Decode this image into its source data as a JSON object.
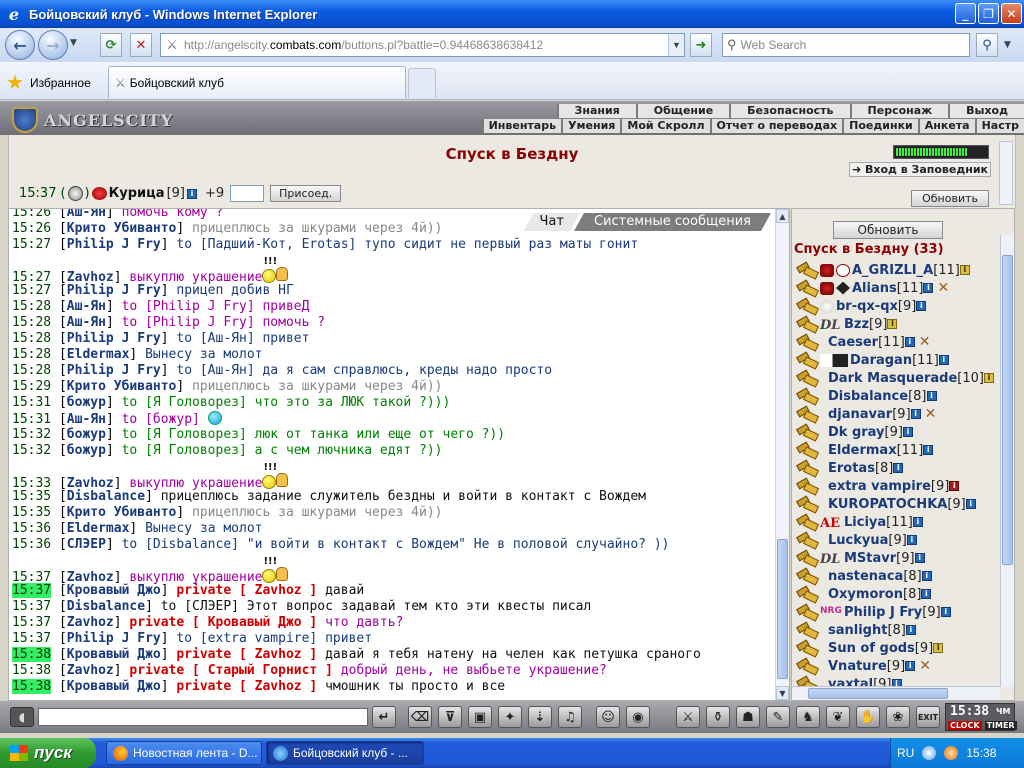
{
  "window": {
    "title": "Бойцовский клуб - Windows Internet Explorer"
  },
  "browser": {
    "url_prefix": "http://angelscity.",
    "url_domain": "combats.com",
    "url_rest": "/buttons.pl?battle=0.94468638638412",
    "search_placeholder": "Web Search",
    "favorites_label": "Избранное",
    "tab_title": "Бойцовский клуб"
  },
  "game": {
    "logo": "ANGELSCITY",
    "menu_top": [
      "Знания",
      "Общение",
      "Безопасность",
      "Персонаж",
      "Выход"
    ],
    "menu_bottom": [
      "Инвентарь",
      "Умения",
      "Мой Скролл",
      "Отчет о переводах",
      "Поединки",
      "Анкета",
      "Настр"
    ],
    "location_title": "Спуск в Бездну",
    "enter_label": "Вход в Заповедник",
    "refresh_label": "Обновить",
    "user": {
      "time": "15:37",
      "nick": "Курица",
      "level": "[9]",
      "bonus": "+9",
      "sit_label": "Присоед."
    }
  },
  "chat": {
    "tabs": {
      "chat": "Чат",
      "system": "Системные сообщения"
    },
    "lines": [
      {
        "time": "15:26",
        "nick": "Аш-Ян",
        "text": "помочь кому ?",
        "color": "purple"
      },
      {
        "time": "15:26",
        "nick": "Крито Убиванто",
        "text": "прицеплюсь за шкурами через 4й))",
        "color": "gray"
      },
      {
        "time": "15:27",
        "nick": "Philip J Fry",
        "to": "to [Падший-Кот, Erotas]",
        "text": "тупо сидит не первый раз маты гонит",
        "color": "navy"
      },
      {
        "time": "15:27",
        "nick": "Zavhoz",
        "text": "выкуплю украшение",
        "color": "purple",
        "smile": "!!!",
        "tall": true
      },
      {
        "time": "15:27",
        "nick": "Philip J Fry",
        "text": "прицеп добив НГ",
        "color": "navy"
      },
      {
        "time": "15:28",
        "nick": "Аш-Ян",
        "to": "to [Philip J Fry]",
        "text": "привеД",
        "color": "purple"
      },
      {
        "time": "15:28",
        "nick": "Аш-Ян",
        "to": "to [Philip J Fry]",
        "text": "помочь ?",
        "color": "purple"
      },
      {
        "time": "15:28",
        "nick": "Philip J Fry",
        "to": "to [Аш-Ян]",
        "text": "привет",
        "color": "navy"
      },
      {
        "time": "15:28",
        "nick": "Eldermax",
        "text": "Вынесу за молот",
        "color": "navy"
      },
      {
        "time": "15:28",
        "nick": "Philip J Fry",
        "to": "to [Аш-Ян]",
        "text": "да я сам справлюсь, креды надо просто",
        "color": "navy"
      },
      {
        "time": "15:29",
        "nick": "Крито Убиванто",
        "text": "прицеплюсь за шкурами через 4й))",
        "color": "gray"
      },
      {
        "time": "15:31",
        "nick": "божур",
        "to": "to [Я Головорез]",
        "text": "что это за ЛЮК такой ?)))",
        "color": "green"
      },
      {
        "time": "15:31",
        "nick": "Аш-Ян",
        "to": "to [божур]",
        "text": "",
        "color": "purple",
        "bluesmile": true
      },
      {
        "time": "15:32",
        "nick": "божур",
        "to": "to [Я Головорез]",
        "text": "люк от танка или еще от чего ?))",
        "color": "green"
      },
      {
        "time": "15:32",
        "nick": "божур",
        "to": "to [Я Головорез]",
        "text": "а с чем лючника едят ?))",
        "color": "green"
      },
      {
        "time": "15:33",
        "nick": "Zavhoz",
        "text": "выкуплю украшение",
        "color": "purple",
        "smile": "!!!",
        "tall": true
      },
      {
        "time": "15:35",
        "nick": "Disbalance",
        "text": "прицеплюсь задание служитель бездны и войти в контакт с Вождем",
        "color": "black"
      },
      {
        "time": "15:35",
        "nick": "Крито Убиванто",
        "text": "прицеплюсь за шкурами через 4й))",
        "color": "gray"
      },
      {
        "time": "15:36",
        "nick": "Eldermax",
        "text": "Вынесу за молот",
        "color": "navy"
      },
      {
        "time": "15:36",
        "nick": "СЛЭЕР",
        "to": "to [Disbalance]",
        "text": "\"и войти в контакт с Вождем\" Не в половой случайно? ))",
        "color": "navy"
      },
      {
        "time": "15:37",
        "nick": "Zavhoz",
        "text": "выкуплю украшение",
        "color": "purple",
        "smile": "!!!",
        "tall": true
      },
      {
        "time": "15:37",
        "hl": true,
        "nick": "Кровавый Джо",
        "private": "private [ Zavhoz ]",
        "text": "давай",
        "color": "black"
      },
      {
        "time": "15:37",
        "nick": "Disbalance",
        "to": "to [СЛЭЕР]",
        "text": "Этот вопрос задавай тем кто эти квесты писал",
        "color": "black"
      },
      {
        "time": "15:37",
        "nick": "Zavhoz",
        "private": "private [ Кровавый Джо ]",
        "text": "что давть?",
        "color": "purple"
      },
      {
        "time": "15:37",
        "nick": "Philip J Fry",
        "to": "to [extra vampire]",
        "text": "привет",
        "color": "navy"
      },
      {
        "time": "15:38",
        "hl": true,
        "nick": "Кровавый Джо",
        "private": "private [ Zavhoz ]",
        "text": "давай я тебя натену на челен как петушка сраного",
        "color": "black"
      },
      {
        "time": "15:38",
        "nick": "Zavhoz",
        "private": "private [ Старый Горнист ]",
        "text": "добрый день, не выбьете украшение?",
        "color": "purple"
      },
      {
        "time": "15:38",
        "hl": true,
        "nick": "Кровавый Джо",
        "private": "private [ Zavhoz ]",
        "text": "чмошник ты просто и все",
        "color": "black"
      }
    ]
  },
  "room": {
    "update_label": "Обновить",
    "title": "Спуск в Бездну (33)",
    "users": [
      {
        "name": "A_GRIZLI_A",
        "level": "[11]",
        "clan": "k1",
        "clan2": "k2",
        "info": "y"
      },
      {
        "name": "Alians",
        "level": "[11]",
        "clan": "k1",
        "clan2": "k3",
        "info": "b",
        "x": true
      },
      {
        "name": "br-qx-qx",
        "level": "[9]",
        "clan": "flower",
        "info": "b"
      },
      {
        "name": "Bzz",
        "level": "[9]",
        "clan": "dl",
        "info": "y"
      },
      {
        "name": "Caeser",
        "level": "[11]",
        "clan": "",
        "info": "b",
        "x": true
      },
      {
        "name": "Daragan",
        "level": "[11]",
        "clan": "wide",
        "info": "b"
      },
      {
        "name": "Dark Masquerade",
        "level": "[10]",
        "clan": "",
        "info": "y"
      },
      {
        "name": "Disbalance",
        "level": "[8]",
        "clan": "",
        "info": "b"
      },
      {
        "name": "djanavar",
        "level": "[9]",
        "clan": "",
        "info": "b",
        "x": true
      },
      {
        "name": "Dk gray",
        "level": "[9]",
        "clan": "",
        "info": "b"
      },
      {
        "name": "Eldermax",
        "level": "[11]",
        "clan": "",
        "info": "b"
      },
      {
        "name": "Erotas",
        "level": "[8]",
        "clan": "",
        "info": "b"
      },
      {
        "name": "extra vampire",
        "level": "[9]",
        "clan": "",
        "info": "r"
      },
      {
        "name": "KUROPATOCHKA",
        "level": "[9]",
        "clan": "",
        "info": "b"
      },
      {
        "name": "Liciya",
        "level": "[11]",
        "clan": "ae",
        "info": "b"
      },
      {
        "name": "Luckyua",
        "level": "[9]",
        "clan": "",
        "info": "b"
      },
      {
        "name": "MStavr",
        "level": "[9]",
        "clan": "dl",
        "info": "b"
      },
      {
        "name": "nastenaca",
        "level": "[8]",
        "clan": "",
        "info": "b"
      },
      {
        "name": "Oxymoron",
        "level": "[8]",
        "clan": "",
        "info": "b"
      },
      {
        "name": "Philip J Fry",
        "level": "[9]",
        "clan": "nrg",
        "info": "b"
      },
      {
        "name": "sanlight",
        "level": "[8]",
        "clan": "",
        "info": "b"
      },
      {
        "name": "Sun of gods",
        "level": "[9]",
        "clan": "",
        "info": "y"
      },
      {
        "name": "Vnature",
        "level": "[9]",
        "clan": "",
        "info": "b",
        "x": true
      },
      {
        "name": "vaxtal",
        "level": "[9]",
        "clan": "",
        "info": "b"
      }
    ]
  },
  "clock": {
    "time": "15:38",
    "sub": "ЧМ",
    "clock_label": "CLOCK",
    "timer_label": "TIMER"
  },
  "taskbar": {
    "start": "пуск",
    "tasks": [
      "Новостная лента - D...",
      "Бойцовский клуб - ..."
    ],
    "lang": "RU",
    "time": "15:38"
  },
  "colors": {
    "location_title": "#8b0000",
    "nick": "#1a3a7a",
    "private": "#d00000",
    "highlight_time": "#33ee66"
  }
}
